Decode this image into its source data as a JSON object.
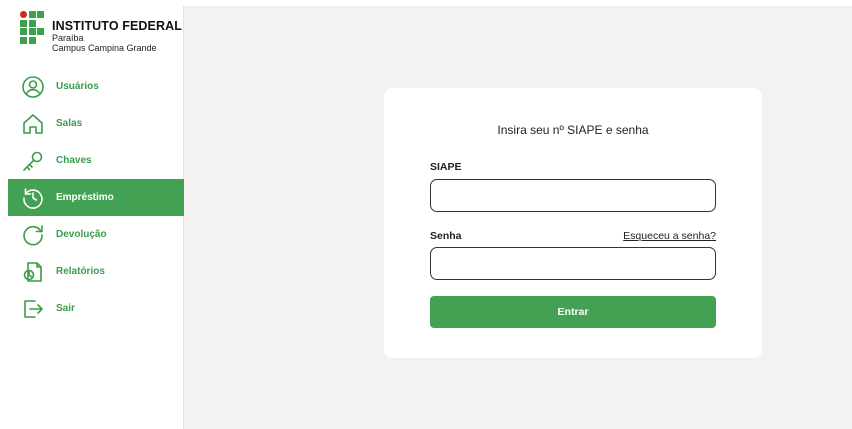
{
  "brand": {
    "title": "INSTITUTO FEDERAL",
    "line1": "Paraíba",
    "line2": "Campus Campina Grande"
  },
  "sidebar": {
    "items": [
      {
        "label": "Usuários",
        "icon": "user-icon",
        "active": false
      },
      {
        "label": "Salas",
        "icon": "house-icon",
        "active": false
      },
      {
        "label": "Chaves",
        "icon": "key-icon",
        "active": false
      },
      {
        "label": "Empréstimo",
        "icon": "history-icon",
        "active": true
      },
      {
        "label": "Devolução",
        "icon": "return-icon",
        "active": false
      },
      {
        "label": "Relatórios",
        "icon": "report-icon",
        "active": false
      },
      {
        "label": "Sair",
        "icon": "logout-icon",
        "active": false
      }
    ]
  },
  "login": {
    "title": "Insira seu nº SIAPE e senha",
    "siape_label": "SIAPE",
    "senha_label": "Senha",
    "forgot_link": "Esqueceu a senha?",
    "submit_label": "Entrar"
  },
  "colors": {
    "accent": "#42a152",
    "logo_red": "#d9261c",
    "background": "#f3f2f1"
  }
}
